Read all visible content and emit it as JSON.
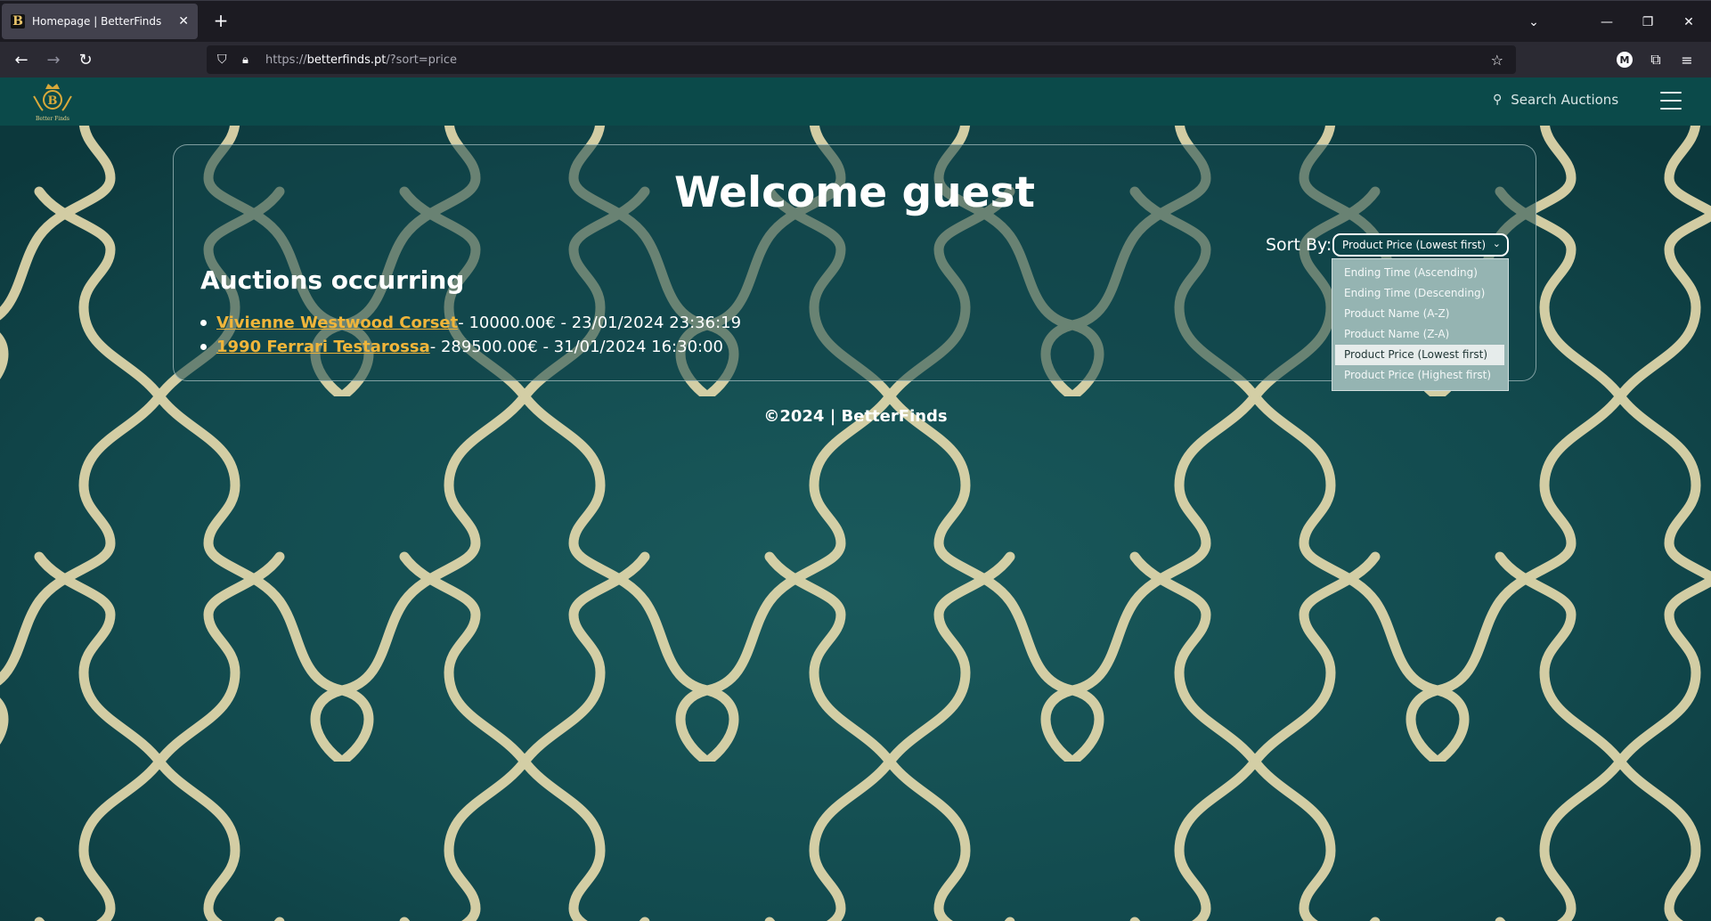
{
  "browser": {
    "tab_title": "Homepage | BetterFinds",
    "tab_favicon_letter": "B",
    "url_prefix": "https://",
    "url_host": "betterfinds.pt",
    "url_path": "/?sort=price",
    "icons": [
      "back-icon",
      "forward-icon",
      "reload-icon",
      "shield-icon",
      "lock-icon",
      "star-icon",
      "account-icon",
      "extensions-icon",
      "menu-icon",
      "tab-list-icon",
      "minimize-icon",
      "restore-icon",
      "close-icon"
    ],
    "account_letter": "M"
  },
  "header": {
    "logo_letter": "B",
    "logo_caption": "Better Finds",
    "search_label": "Search Auctions"
  },
  "main": {
    "welcome": "Welcome guest",
    "sort_label": "Sort By:",
    "sort_selected": "Product Price (Lowest first)",
    "sort_options": [
      "Ending Time (Ascending)",
      "Ending Time (Descending)",
      "Product Name (A-Z)",
      "Product Name (Z-A)",
      "Product Price (Lowest first)",
      "Product Price (Highest first)"
    ],
    "auctions_title": "Auctions occurring",
    "auctions": [
      {
        "name": "Vivienne Westwood Corset",
        "details": " - 10000.00€ - 23/01/2024 23:36:19"
      },
      {
        "name": "1990 Ferrari Testarossa",
        "details": " - 289500.00€ - 31/01/2024 16:30:00"
      }
    ]
  },
  "footer": {
    "text": "©2024 | BetterFinds"
  },
  "colors": {
    "brand_teal": "#0b4a4a",
    "link_gold": "#f0b53a",
    "pattern_gold": "#e8dcae"
  }
}
